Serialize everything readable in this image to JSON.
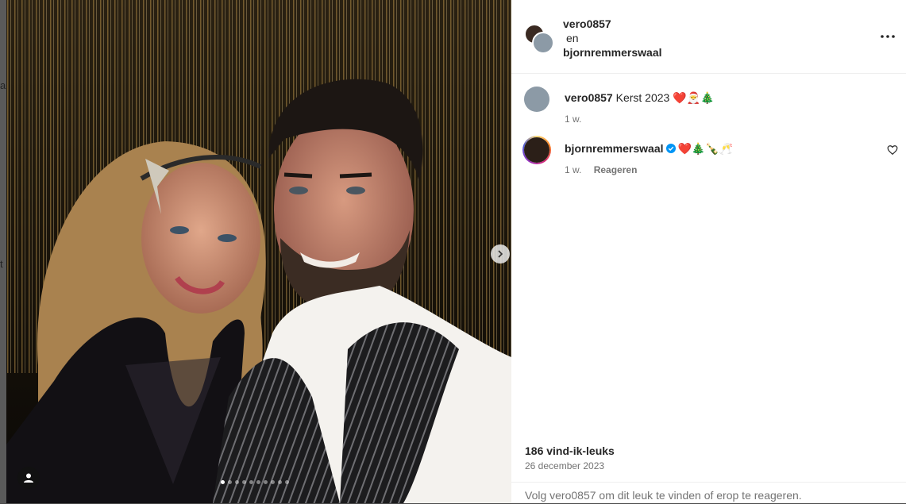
{
  "backdrop": {
    "letters": [
      "a",
      "t"
    ]
  },
  "photo": {
    "alt_icons": {
      "next": "chevron-right-icon",
      "tag": "user-tag-icon"
    },
    "carousel": {
      "count": 10,
      "active": 0
    }
  },
  "header": {
    "user1": "vero0857",
    "joiner": "en",
    "user2": "bjornremmerswaal",
    "more_icon": "more-horizontal-icon"
  },
  "comments": [
    {
      "user": "vero0857",
      "text": "Kerst 2023 ❤️🎅🎄",
      "time": "1 w."
    },
    {
      "user": "bjornremmerswaal",
      "verified": true,
      "text": "❤️🎄🍾🥂",
      "time": "1 w.",
      "reply": "Reageren"
    }
  ],
  "likes": "186 vind-ik-leuks",
  "date": "26 december 2023",
  "footer": "Volg vero0857 om dit leuk te vinden of erop te reageren.",
  "colors": {
    "verified": "#0095f6",
    "muted": "#737373",
    "text": "#262626"
  }
}
